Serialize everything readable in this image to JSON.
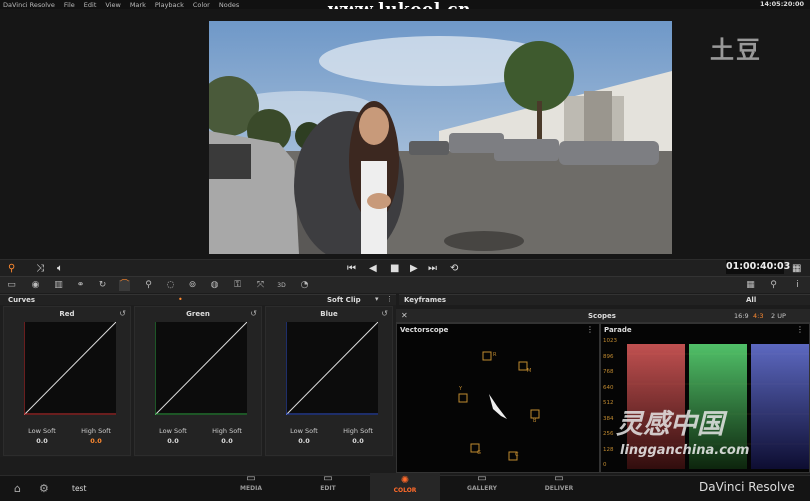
{
  "app": {
    "name": "DaVinci Resolve",
    "menu": [
      "File",
      "Edit",
      "View",
      "Mark",
      "Playback",
      "Color",
      "Nodes"
    ],
    "clock": "14:05:20:00"
  },
  "watermarks": {
    "top": "www.lukool.cn",
    "tudou": "土豆",
    "bottom_logo": "灵感中国",
    "bottom_url": "lingganchina.com"
  },
  "transport": {
    "timecode": "01:00:40:03"
  },
  "curves": {
    "title": "Curves",
    "mode": "Soft Clip",
    "channels": [
      {
        "name": "Red",
        "color": "#c83030",
        "low_label": "Low Soft",
        "low_value": "0.0",
        "high_label": "High Soft",
        "high_value": "0.0",
        "high_color": "#ff8a30"
      },
      {
        "name": "Green",
        "color": "#2ea040",
        "low_label": "Low Soft",
        "low_value": "0.0",
        "high_label": "High Soft",
        "high_value": "0.0",
        "high_color": "#dddddd"
      },
      {
        "name": "Blue",
        "color": "#3050c8",
        "low_label": "Low Soft",
        "low_value": "0.0",
        "high_label": "High Soft",
        "high_value": "0.0",
        "high_color": "#dddddd"
      }
    ]
  },
  "keyframes": {
    "title": "Keyframes",
    "filter": "All"
  },
  "scopes": {
    "title": "Scopes",
    "ratios": [
      "16:9",
      "4:3"
    ],
    "layout": "2 UP",
    "vectorscope_title": "Vectorscope",
    "parade_title": "Parade",
    "parade_ticks": [
      "1023",
      "896",
      "768",
      "640",
      "512",
      "384",
      "256",
      "128",
      "0"
    ],
    "vector_targets": [
      "R",
      "M",
      "B",
      "C",
      "G",
      "Y"
    ]
  },
  "bottom": {
    "project": "test",
    "tabs": [
      "MEDIA",
      "EDIT",
      "COLOR",
      "GALLERY",
      "DELIVER"
    ],
    "active_tab": "COLOR"
  },
  "colors": {
    "accent": "#ff6a2a"
  }
}
